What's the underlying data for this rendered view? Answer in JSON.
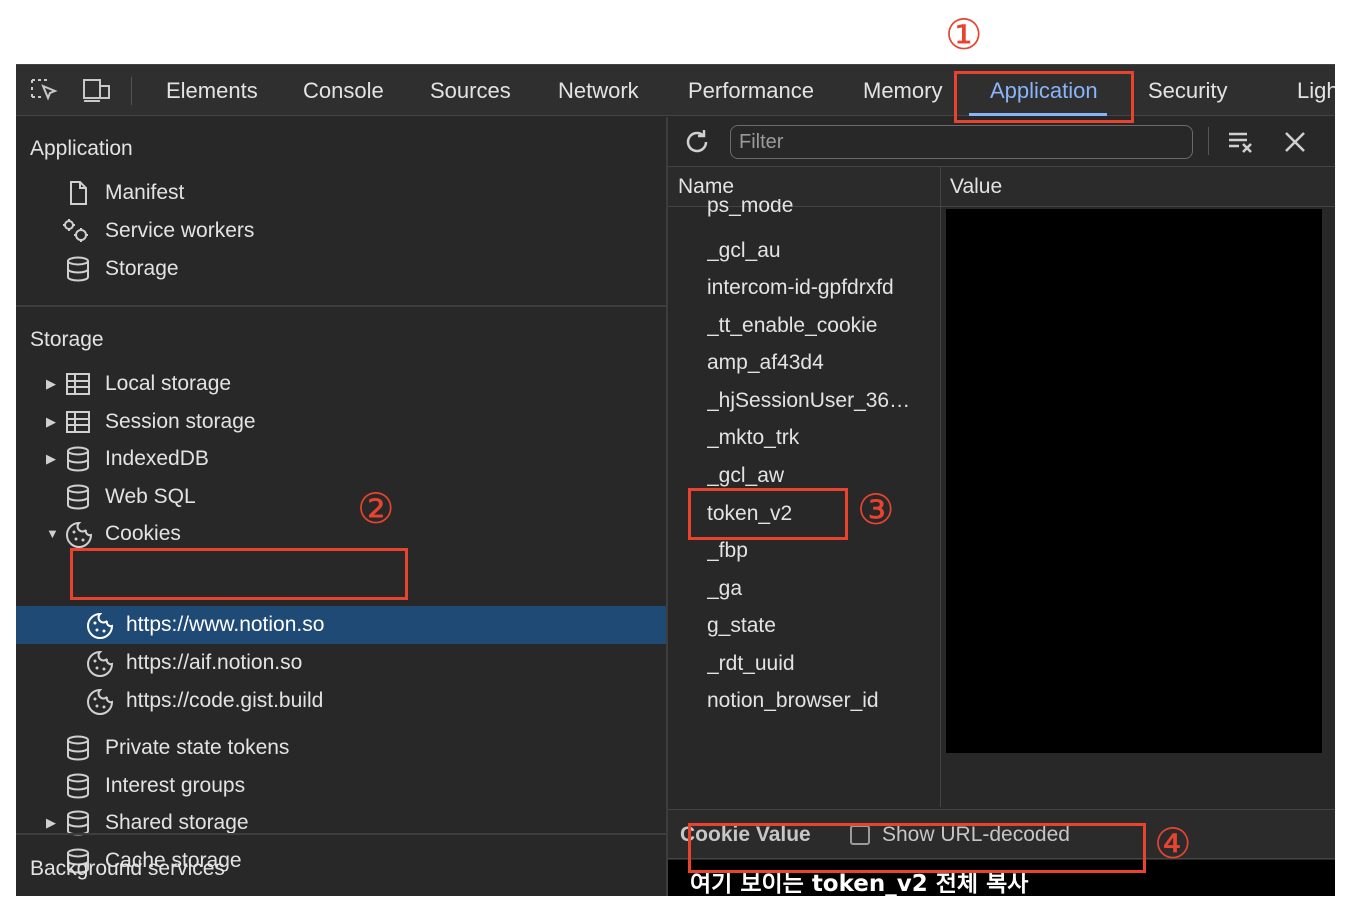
{
  "toolbar": {
    "tabs": [
      "Elements",
      "Console",
      "Sources",
      "Network",
      "Performance",
      "Memory",
      "Application",
      "Security",
      "Ligh"
    ],
    "active_tab": "Application"
  },
  "sidebar": {
    "application_title": "Application",
    "application_items": [
      "Manifest",
      "Service workers",
      "Storage"
    ],
    "storage_title": "Storage",
    "storage_items": [
      "Local storage",
      "Session storage",
      "IndexedDB",
      "Web SQL",
      "Cookies"
    ],
    "cookie_hosts": [
      "https://www.notion.so",
      "https://aif.notion.so",
      "https://code.gist.build"
    ],
    "storage_items_after": [
      "Private state tokens",
      "Interest groups",
      "Shared storage",
      "Cache storage"
    ],
    "background_title": "Background services"
  },
  "right": {
    "filter_placeholder": "Filter",
    "col_name": "Name",
    "col_value": "Value",
    "cookie_names": [
      "ps_mode",
      "_gcl_au",
      "intercom-id-gpfdrxfd",
      "_tt_enable_cookie",
      "amp_af43d4",
      "_hjSessionUser_36…",
      "_mkto_trk",
      "_gcl_aw",
      "token_v2",
      "_fbp",
      "_ga",
      "g_state",
      "_rdt_uuid",
      "notion_browser_id"
    ],
    "cookie_value_label": "Cookie Value",
    "show_decoded": "Show URL-decoded",
    "cookie_value_text": "여기 보이는 token_v2 전체 복사"
  },
  "annotations": {
    "n1": "①",
    "n2": "②",
    "n3": "③",
    "n4": "④",
    "color": "#e8432f"
  },
  "colors": {
    "accent": "#8ab4f8",
    "selected_row": "#1f4a75"
  }
}
